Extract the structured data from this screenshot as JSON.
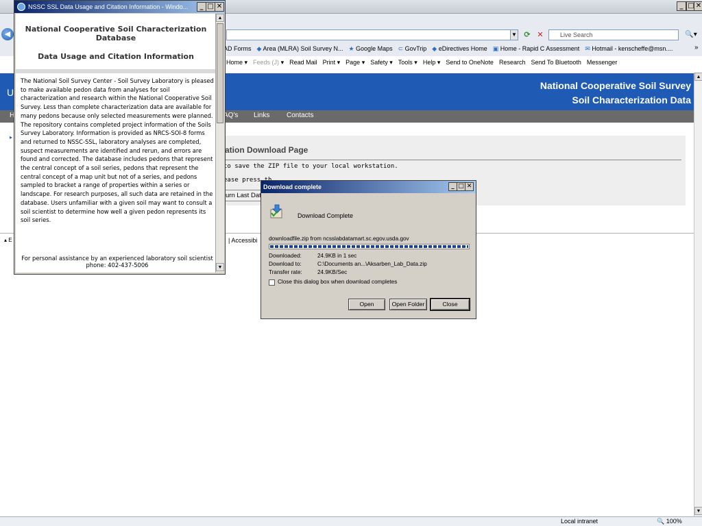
{
  "browser": {
    "search_placeholder": "Live Search",
    "favorites": [
      "AD Forms",
      "Area (MLRA) Soil Survey N...",
      "Google Maps",
      "GovTrip",
      "eDirectives Home",
      "Home - Rapid C Assessment",
      "Hotmail - kenscheffe@msn...."
    ],
    "commands": [
      "Home",
      "Feeds (J)",
      "Read Mail",
      "Print",
      "Page",
      "Safety",
      "Tools",
      "Help",
      "Send to OneNote",
      "Research",
      "Send To Bluetooth",
      "Messenger"
    ],
    "status": {
      "zone": "Local intranet",
      "zoom": "100%"
    }
  },
  "page": {
    "header_left": "U",
    "title_line1": "National Cooperative Soil Survey",
    "title_line2": "Soil Characterization Data",
    "nav": [
      "H",
      "AQ's",
      "Links",
      "Contacts"
    ],
    "heading": "ation Download Page",
    "line1": "to save the ZIP file to your local workstation.",
    "line2": "ease press th",
    "return_button": "urn Last Dat",
    "footer_left": "E",
    "footer_accessibility": "| Accessibi"
  },
  "citation_window": {
    "title": "NSSC SSL Data Usage and Citation Information - Windo...",
    "heading1": "National Cooperative Soil Characterization Database",
    "heading2": "Data Usage and Citation Information",
    "paragraph": "The National Soil Survey Center - Soil Survey Laboratory is pleased to make available pedon data from analyses for soil characterization and research within the National Cooperative Soil Survey. Less than complete characterization data are available for many pedons because only selected measurements were planned. The repository contains completed project information of the Soils Survey Laboratory. Information is provided as NRCS-SOI-8 forms and returned to NSSC-SSL, laboratory analyses are completed, suspect measurements are identified and rerun, and errors are found and corrected. The database includes pedons that represent the central concept of a soil series, pedons that represent the central concept of a map unit but not of a series, and pedons sampled to bracket a range of properties within a series or landscape. For research purposes, all such data are retained in the database. Users unfamiliar with a given soil may want to consult a soil scientist to determine how well a given pedon represents its soil series.",
    "assistance": "For personal assistance by an experienced laboratory soil scientist phone: 402-437-5006"
  },
  "download_dialog": {
    "title": "Download complete",
    "heading": "Download Complete",
    "source": "downloadfile.zip from ncsslabdatamart.sc.egov.usda.gov",
    "progress_fraction": 1.0,
    "rows": [
      {
        "label": "Downloaded:",
        "value": "24.9KB in 1 sec"
      },
      {
        "label": "Download to:",
        "value": "C:\\Documents an...\\Aksarben_Lab_Data.zip"
      },
      {
        "label": "Transfer rate:",
        "value": "24.9KB/Sec"
      }
    ],
    "checkbox_label": "Close this dialog box when download completes",
    "checkbox_checked": false,
    "buttons": {
      "open": "Open",
      "open_folder": "Open Folder",
      "close": "Close"
    }
  }
}
